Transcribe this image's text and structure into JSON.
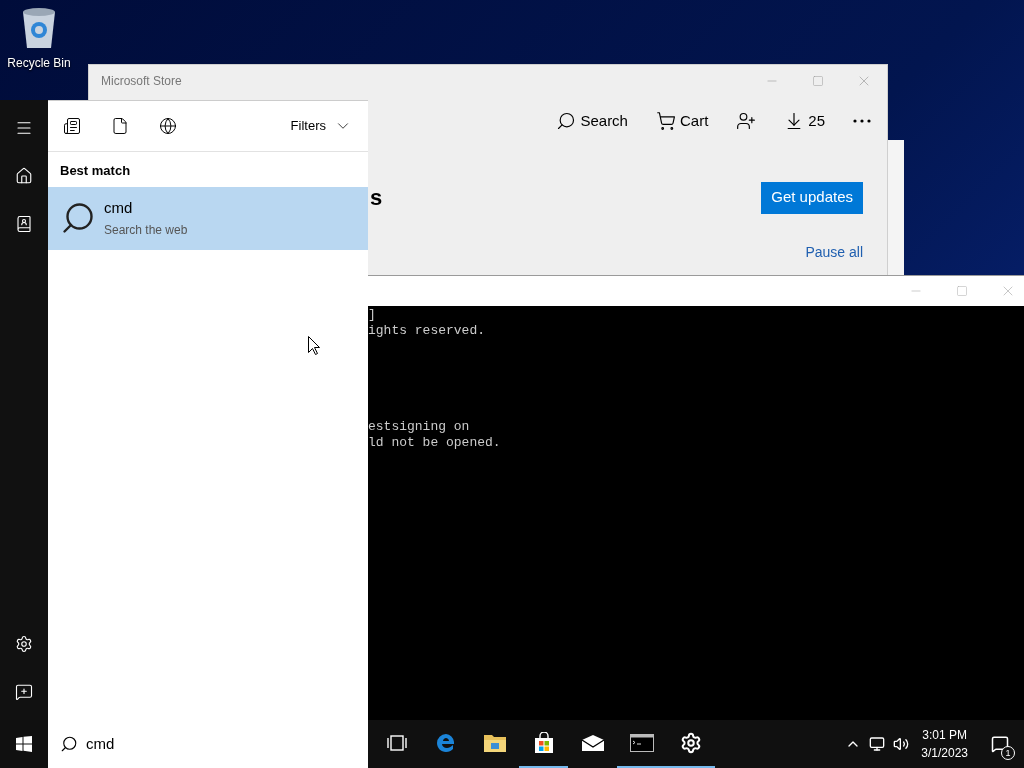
{
  "desktop_icons": [
    {
      "label": "Recycle Bin"
    }
  ],
  "store_window": {
    "title": "Microsoft Store",
    "toolbar": [
      {
        "kind": "search",
        "label": "Search"
      },
      {
        "kind": "cart",
        "label": "Cart"
      },
      {
        "kind": "account"
      },
      {
        "kind": "downloads",
        "label": "25"
      },
      {
        "kind": "more"
      }
    ],
    "heading_fragment": "s",
    "primary_button": "Get updates",
    "link": "Pause all"
  },
  "console_window": {
    "blocks": [
      {
        "lines": [
          "]",
          "ights reserved."
        ]
      },
      {
        "lines": [
          "estsigning on",
          "ld not be opened."
        ]
      }
    ]
  },
  "start_menu": {
    "rail": [
      {
        "kind": "menu"
      },
      {
        "kind": "home"
      },
      {
        "kind": "documents"
      }
    ],
    "rail_bottom": [
      {
        "kind": "settings"
      },
      {
        "kind": "feedback"
      }
    ],
    "filters": [
      {
        "kind": "apps"
      },
      {
        "kind": "documents"
      },
      {
        "kind": "web"
      }
    ],
    "filters_label": "Filters",
    "section": "Best match",
    "results": [
      {
        "title": "cmd",
        "subtitle": "Search the web",
        "selected": true
      }
    ],
    "search": {
      "value": "cmd"
    }
  },
  "taskbar": {
    "apps": [
      {
        "kind": "task-view",
        "running": false
      },
      {
        "kind": "edge",
        "running": false
      },
      {
        "kind": "explorer",
        "running": false
      },
      {
        "kind": "store",
        "running": true
      },
      {
        "kind": "mail",
        "running": false
      },
      {
        "kind": "console",
        "running": true
      },
      {
        "kind": "settings",
        "running": true
      }
    ],
    "clock": {
      "time": "3:01 PM",
      "date": "3/1/2023"
    },
    "notifications": "1"
  }
}
